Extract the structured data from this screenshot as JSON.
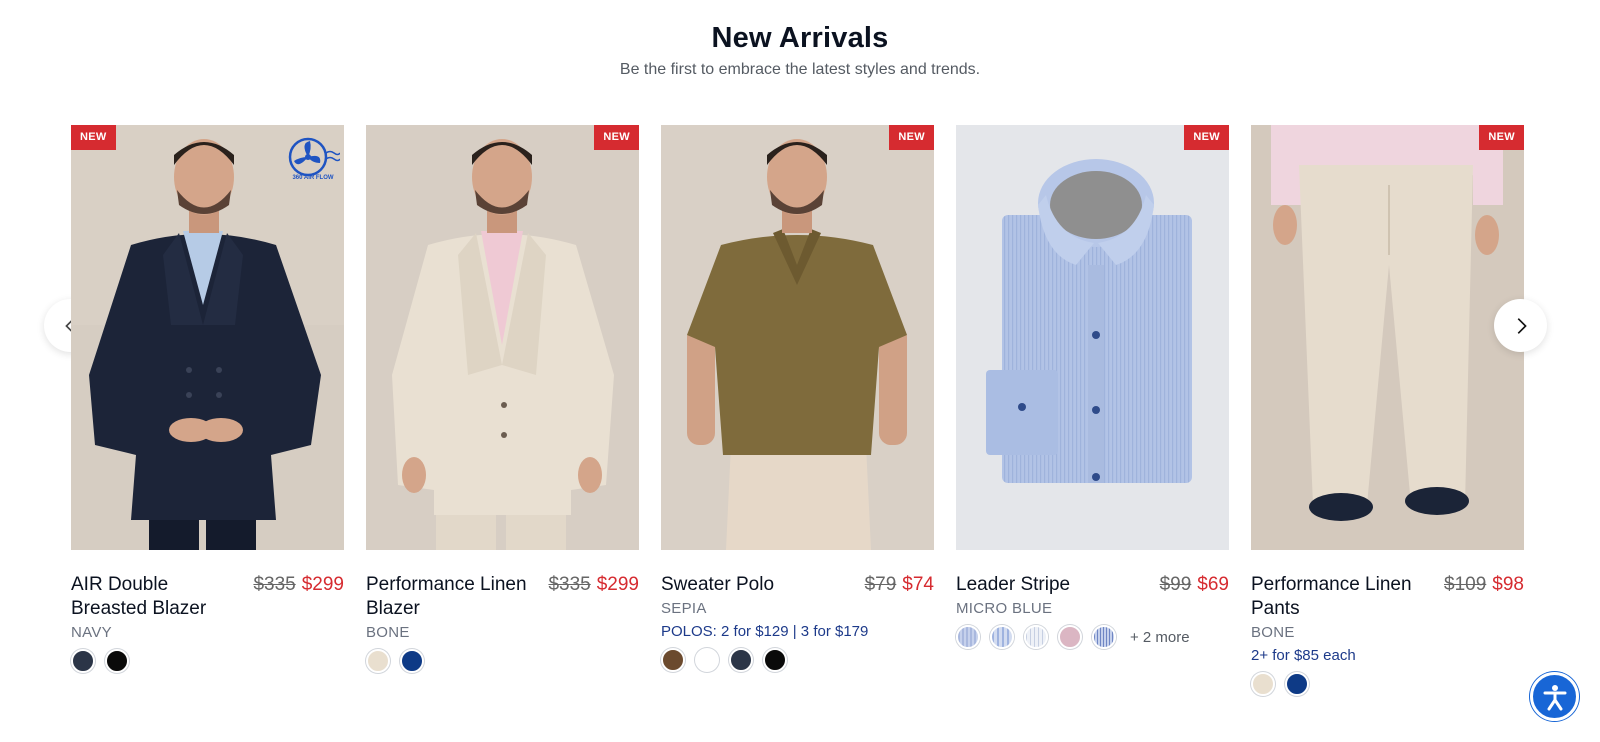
{
  "section": {
    "title": "New Arrivals",
    "subtitle": "Be the first to embrace the latest styles and trends."
  },
  "badge_text": "NEW",
  "airflow_logo_text": "360 AIR FLOW",
  "products": [
    {
      "name": "AIR Double Breasted Blazer",
      "old_price": "$335",
      "price": "$299",
      "color": "NAVY",
      "promo": "",
      "swatches": [
        "#2b3547",
        "#0a0a0a"
      ],
      "more": ""
    },
    {
      "name": "Performance Linen Blazer",
      "old_price": "$335",
      "price": "$299",
      "color": "BONE",
      "promo": "",
      "swatches": [
        "#e9dfcf",
        "#0e3a86"
      ],
      "more": ""
    },
    {
      "name": "Sweater Polo",
      "old_price": "$79",
      "price": "$74",
      "color": "SEPIA",
      "promo": "POLOS: 2 for $129 | 3 for $179",
      "swatches": [
        "#6b4a2e",
        "#ffffff",
        "#2b3547",
        "#0a0a0a"
      ],
      "more": ""
    },
    {
      "name": "Leader Stripe",
      "old_price": "$99",
      "price": "$69",
      "color": "MICRO BLUE",
      "promo": "",
      "swatches": [
        "#a9b8de",
        "#b5c6ea",
        "#cfd8ea",
        "#d9b3c0",
        "#9eb2de"
      ],
      "more": "+ 2 more"
    },
    {
      "name": "Performance Linen Pants",
      "old_price": "$109",
      "price": "$98",
      "color": "BONE",
      "promo": "2+ for $85 each",
      "swatches": [
        "#e9dfcf",
        "#0e3a86"
      ],
      "more": ""
    }
  ],
  "colors": {
    "badge": "#d62b30",
    "sale_price": "#d62b30",
    "promo": "#1d3a8a",
    "accessibility": "#1866d6"
  }
}
